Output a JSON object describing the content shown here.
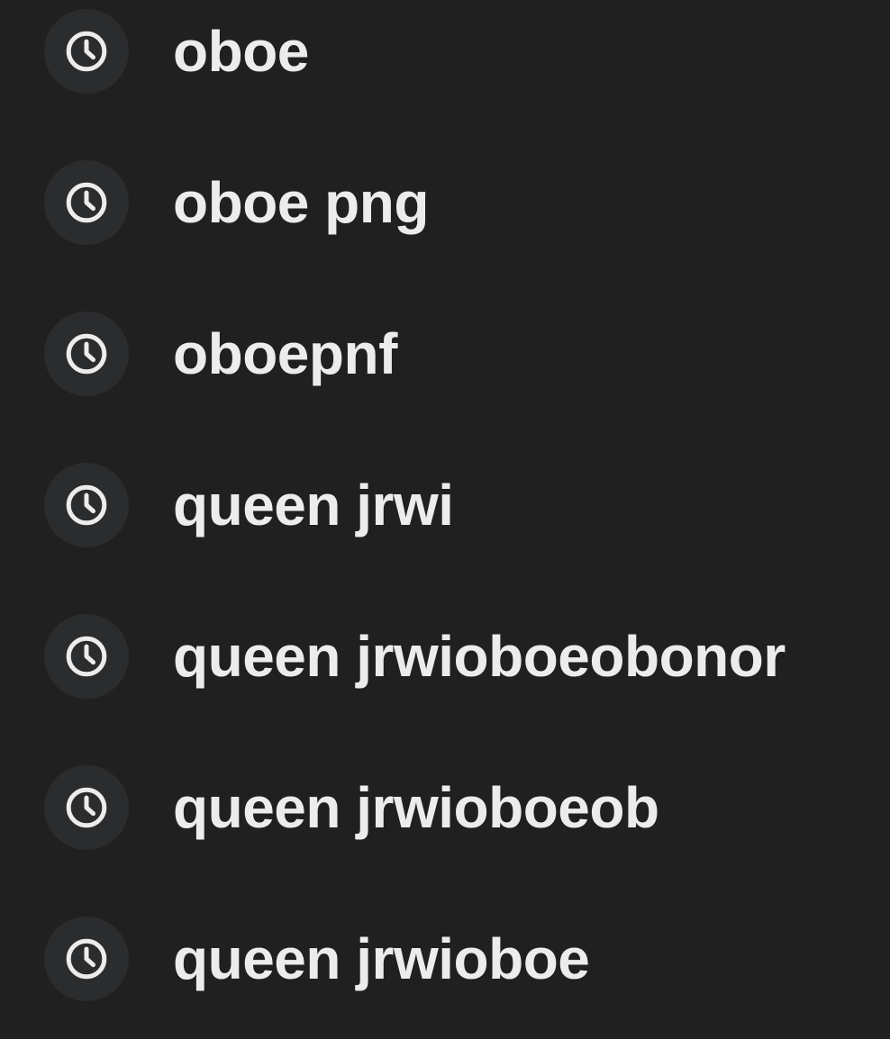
{
  "history": {
    "items": [
      {
        "label": "oboe",
        "icon": "clock-icon"
      },
      {
        "label": "oboe png",
        "icon": "clock-icon"
      },
      {
        "label": "oboepnf",
        "icon": "clock-icon"
      },
      {
        "label": "queen jrwi",
        "icon": "clock-icon"
      },
      {
        "label": "queen jrwioboeobonor",
        "icon": "clock-icon"
      },
      {
        "label": "queen jrwioboeob",
        "icon": "clock-icon"
      },
      {
        "label": "queen jrwioboe",
        "icon": "clock-icon"
      }
    ]
  },
  "colors": {
    "background": "#202020",
    "icon_bg": "#2b2c2e",
    "text": "#ececec"
  }
}
